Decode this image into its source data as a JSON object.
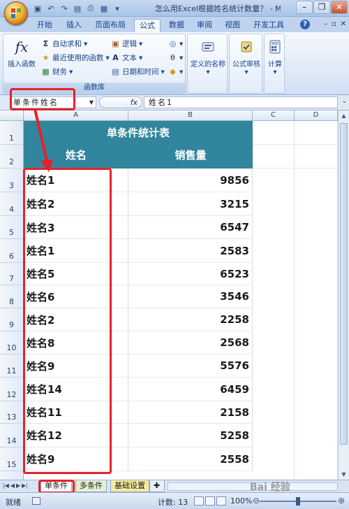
{
  "window": {
    "title": "怎么用Excel根据姓名统计数量？ - Mic..."
  },
  "ribbon": {
    "tabs": [
      "开始",
      "插入",
      "页面布局",
      "公式",
      "数据",
      "审阅",
      "视图",
      "开发工具"
    ],
    "active_tab": "公式",
    "function_library": {
      "label": "函数库",
      "insert_function": "插入函数",
      "autosum": "自动求和",
      "recently_used": "最近使用的函数",
      "financial": "财务",
      "logical": "逻辑",
      "text": "文本",
      "datetime": "日期和时间"
    },
    "defined_names": "定义的名称",
    "formula_auditing": "公式审核",
    "calculation": "计算"
  },
  "formula_bar": {
    "name_box": "单条件姓名",
    "fx": "fx",
    "formula": "姓名1"
  },
  "grid": {
    "columns": [
      "A",
      "B",
      "C",
      "D"
    ],
    "table_title": "单条件统计表",
    "header_name": "姓名",
    "header_sales": "销售量",
    "rows": [
      {
        "row": "1"
      },
      {
        "row": "2"
      },
      {
        "row": "3",
        "name": "姓名1",
        "value": "9856"
      },
      {
        "row": "4",
        "name": "姓名2",
        "value": "3215"
      },
      {
        "row": "5",
        "name": "姓名3",
        "value": "6547"
      },
      {
        "row": "6",
        "name": "姓名1",
        "value": "2583"
      },
      {
        "row": "7",
        "name": "姓名5",
        "value": "6523"
      },
      {
        "row": "8",
        "name": "姓名6",
        "value": "3546"
      },
      {
        "row": "9",
        "name": "姓名2",
        "value": "2258"
      },
      {
        "row": "10",
        "name": "姓名8",
        "value": "2568"
      },
      {
        "row": "11",
        "name": "姓名9",
        "value": "5576"
      },
      {
        "row": "12",
        "name": "姓名14",
        "value": "6459"
      },
      {
        "row": "13",
        "name": "姓名11",
        "value": "2158"
      },
      {
        "row": "14",
        "name": "姓名12",
        "value": "5258"
      },
      {
        "row": "15",
        "name": "姓名9",
        "value": "2558"
      }
    ]
  },
  "sheets": {
    "tabs": [
      "单条件",
      "多条件",
      "基础设置"
    ],
    "active": "单条件"
  },
  "status_bar": {
    "ready": "就绪",
    "count": "计数: 13",
    "zoom": "100%"
  },
  "watermark": "Bai 经验",
  "colors": {
    "header_fill": "#31859c",
    "annotation_red": "#e8202a"
  }
}
